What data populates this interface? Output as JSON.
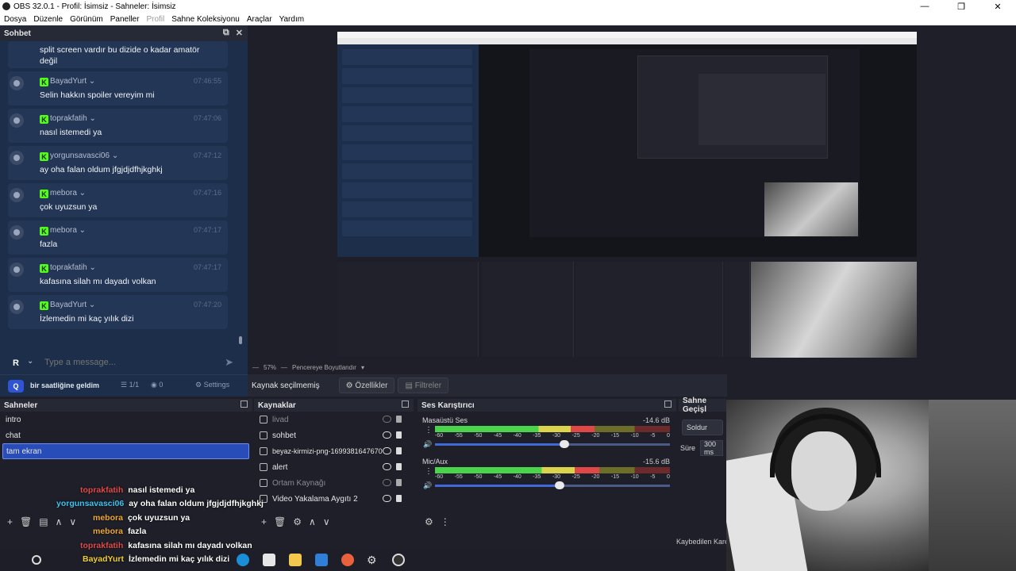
{
  "window": {
    "title": "OBS 32.0.1 - Profil: İsimsiz - Sahneler: İsimsiz",
    "buttons": [
      "—",
      "❐",
      "✕"
    ]
  },
  "menu": [
    "Dosya",
    "Düzenle",
    "Görünüm",
    "Paneller",
    "Profil",
    "Sahne Koleksiyonu",
    "Araçlar",
    "Yardım"
  ],
  "chat": {
    "dock_title": "Sohbet",
    "first_message": "split screen vardır bu dizide o kadar amatör değil",
    "messages": [
      {
        "user": "BayadYurt",
        "time": "07:46:55",
        "text": "Selin hakkın spoiler vereyim mi"
      },
      {
        "user": "toprakfatih",
        "time": "07:47:06",
        "text": "nasıl istemedi ya"
      },
      {
        "user": "yorgunsavasci06",
        "time": "07:47:12",
        "text": "ay oha falan oldum jfgjdjdfhjkghkj"
      },
      {
        "user": "mebora",
        "time": "07:47:16",
        "text": "çok uyuzsun ya"
      },
      {
        "user": "mebora",
        "time": "07:47:17",
        "text": "fazla"
      },
      {
        "user": "toprakfatih",
        "time": "07:47:17",
        "text": "kafasına silah mı dayadı volkan"
      },
      {
        "user": "BayadYurt",
        "time": "07:47:20",
        "text": "İzlemedin mi kaç yılık dizi"
      }
    ],
    "input_placeholder": "Type a message...",
    "stream_title": "bir saatliğine geldim",
    "viewers": "1/1",
    "eye_count": "0",
    "settings_label": "Settings"
  },
  "preview": {
    "zoom": "57%",
    "fit_label": "Pencereye Boyutlandır"
  },
  "context": {
    "no_source": "Kaynak seçilmemiş",
    "properties": "Özellikler",
    "filters": "Filtreler"
  },
  "scenes": {
    "title": "Sahneler",
    "items": [
      "intro",
      "chat",
      "tam ekran"
    ]
  },
  "sources": {
    "title": "Kaynaklar",
    "items": [
      "livad",
      "sohbet",
      "beyaz-kirmizi-png-1699381647670",
      "alert",
      "Ortam Kaynağı",
      "Video Yakalama Aygıtı 2"
    ]
  },
  "mixer": {
    "title": "Ses Karıştırıcı",
    "channels": [
      {
        "name": "Masaüstü Ses",
        "db": "-14.6 dB",
        "level": 0.68,
        "volume": 0.55
      },
      {
        "name": "Mic/Aux",
        "db": "-15.6 dB",
        "level": 0.7,
        "volume": 0.53
      }
    ],
    "scale": [
      "-60",
      "-55",
      "-50",
      "-45",
      "-40",
      "-35",
      "-30",
      "-25",
      "-20",
      "-15",
      "-10",
      "-5",
      "0"
    ]
  },
  "transitions": {
    "title": "Sahne Geçişl",
    "selected": "Soldur",
    "duration_label": "Süre",
    "duration": "300 ms"
  },
  "status": {
    "lost_frames": "Kaybedilen Kare"
  },
  "overlay_chat": [
    {
      "user": "toprakfatih",
      "text": "nasıl istemedi ya",
      "color": "#e24a4a"
    },
    {
      "user": "yorgunsavasci06",
      "text": "ay oha falan oldum jfgjdjdfhjkghkj",
      "color": "#3cc6f0"
    },
    {
      "user": "mebora",
      "text": "çok uyuzsun ya",
      "color": "#f0a830"
    },
    {
      "user": "mebora",
      "text": "fazla",
      "color": "#f0a830"
    },
    {
      "user": "toprakfatih",
      "text": "kafasına silah mı dayadı volkan",
      "color": "#e24a4a"
    },
    {
      "user": "BayadYurt",
      "text": "İzlemedin mi kaç yılık dizi",
      "color": "#f0d030"
    }
  ]
}
